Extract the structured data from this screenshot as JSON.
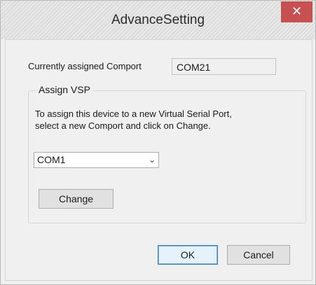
{
  "window": {
    "title": "AdvanceSetting",
    "close_glyph": "✕"
  },
  "current": {
    "label": "Currently assigned Comport",
    "value": "COM21"
  },
  "assign_vsp": {
    "legend": "Assign VSP",
    "description_line1": "To assign this device to a new Virtual Serial Port,",
    "description_line2": "select a new Comport and click on Change.",
    "selected_port": "COM1",
    "dropdown_glyph": "⌄",
    "change_label": "Change"
  },
  "footer": {
    "ok_label": "OK",
    "cancel_label": "Cancel"
  },
  "colors": {
    "close_button": "#c75050",
    "background": "#f0f0f0",
    "default_button_border": "#3c7fb1"
  }
}
